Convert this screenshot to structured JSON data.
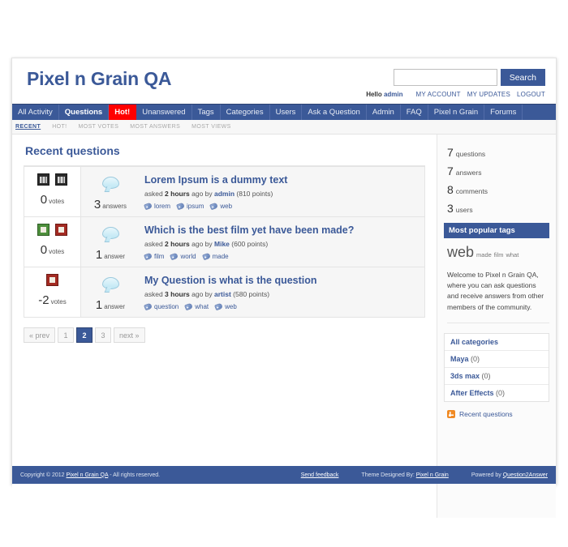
{
  "header": {
    "site_title": "Pixel n Grain QA",
    "search": {
      "value": "",
      "placeholder": "",
      "button_label": "Search"
    },
    "account": {
      "hello_prefix": "Hello ",
      "hello_user": "admin",
      "links": [
        "MY ACCOUNT",
        "MY UPDATES",
        "LOGOUT"
      ]
    }
  },
  "nav": {
    "items": [
      {
        "label": "All Activity",
        "state": "normal"
      },
      {
        "label": "Questions",
        "state": "selected"
      },
      {
        "label": "Hot!",
        "state": "hot"
      },
      {
        "label": "Unanswered",
        "state": "normal"
      },
      {
        "label": "Tags",
        "state": "normal"
      },
      {
        "label": "Categories",
        "state": "normal"
      },
      {
        "label": "Users",
        "state": "normal"
      },
      {
        "label": "Ask a Question",
        "state": "normal"
      },
      {
        "label": "Admin",
        "state": "normal"
      },
      {
        "label": "FAQ",
        "state": "normal"
      },
      {
        "label": "Pixel n Grain",
        "state": "normal"
      },
      {
        "label": "Forums",
        "state": "normal"
      }
    ]
  },
  "subnav": {
    "items": [
      {
        "label": "RECENT",
        "selected": true
      },
      {
        "label": "HOT!",
        "selected": false
      },
      {
        "label": "MOST VOTES",
        "selected": false
      },
      {
        "label": "MOST ANSWERS",
        "selected": false
      },
      {
        "label": "MOST VIEWS",
        "selected": false
      }
    ]
  },
  "main": {
    "page_title": "Recent questions",
    "questions": [
      {
        "votes": "0",
        "votes_label": "votes",
        "vote_icons": [
          "broken",
          "broken"
        ],
        "answers": "3",
        "answers_label": "answers",
        "title": "Lorem Ipsum is a dummy text",
        "meta_prefix": "asked ",
        "meta_time": "2 hours",
        "meta_mid": " ago by ",
        "meta_user": "admin",
        "meta_points": " (810 points)",
        "tags": [
          "lorem",
          "ipsum",
          "web"
        ]
      },
      {
        "votes": "0",
        "votes_label": "votes",
        "vote_icons": [
          "up",
          "down"
        ],
        "answers": "1",
        "answers_label": "answer",
        "title": "Which is the best film yet have been made?",
        "meta_prefix": "asked ",
        "meta_time": "2 hours",
        "meta_mid": " ago by ",
        "meta_user": "Mike",
        "meta_points": " (600 points)",
        "tags": [
          "film",
          "world",
          "made"
        ]
      },
      {
        "votes": "-2",
        "votes_label": "votes",
        "vote_icons": [
          "down"
        ],
        "answers": "1",
        "answers_label": "answer",
        "title": "My Question is what is the question",
        "meta_prefix": "asked ",
        "meta_time": "3 hours",
        "meta_mid": " ago by ",
        "meta_user": "artist",
        "meta_points": " (580 points)",
        "tags": [
          "question",
          "what",
          "web"
        ]
      }
    ],
    "pagination": [
      {
        "label": "« prev",
        "selected": false
      },
      {
        "label": "1",
        "selected": false
      },
      {
        "label": "2",
        "selected": true
      },
      {
        "label": "3",
        "selected": false
      },
      {
        "label": "next »",
        "selected": false
      }
    ]
  },
  "sidebar": {
    "stats": [
      {
        "value": "7",
        "label": "questions"
      },
      {
        "value": "7",
        "label": "answers"
      },
      {
        "value": "8",
        "label": "comments"
      },
      {
        "value": "3",
        "label": "users"
      }
    ],
    "tags_heading": "Most popular tags",
    "tag_cloud": [
      {
        "label": "web",
        "size": "big"
      },
      {
        "label": "made",
        "size": "small"
      },
      {
        "label": "film",
        "size": "small"
      },
      {
        "label": "what",
        "size": "small"
      }
    ],
    "welcome": "Welcome to Pixel n Grain QA, where you can ask questions and receive answers from other members of the community.",
    "categories": [
      {
        "label": "All categories",
        "count": ""
      },
      {
        "label": "Maya",
        "count": " (0)"
      },
      {
        "label": "3ds max",
        "count": " (0)"
      },
      {
        "label": "After Effects",
        "count": " (0)"
      }
    ],
    "rss_label": "Recent questions"
  },
  "footer": {
    "copyright_pre": "Copyright © 2012 ",
    "copyright_link": "Pixel n Grain QA",
    "copyright_post": " - All rights reserved.",
    "send_feedback": "Send feedback",
    "theme_pre": "Theme Designed By: ",
    "theme_link": "Pixel n Grain",
    "powered_pre": "Powered by ",
    "powered_link": "Question2Answer"
  },
  "colors": {
    "brand": "#3b5998",
    "hot": "#ff0000",
    "page_bg": "#ffffff",
    "panel_bg": "#f6f6f6",
    "rss_orange": "#f08a24"
  }
}
